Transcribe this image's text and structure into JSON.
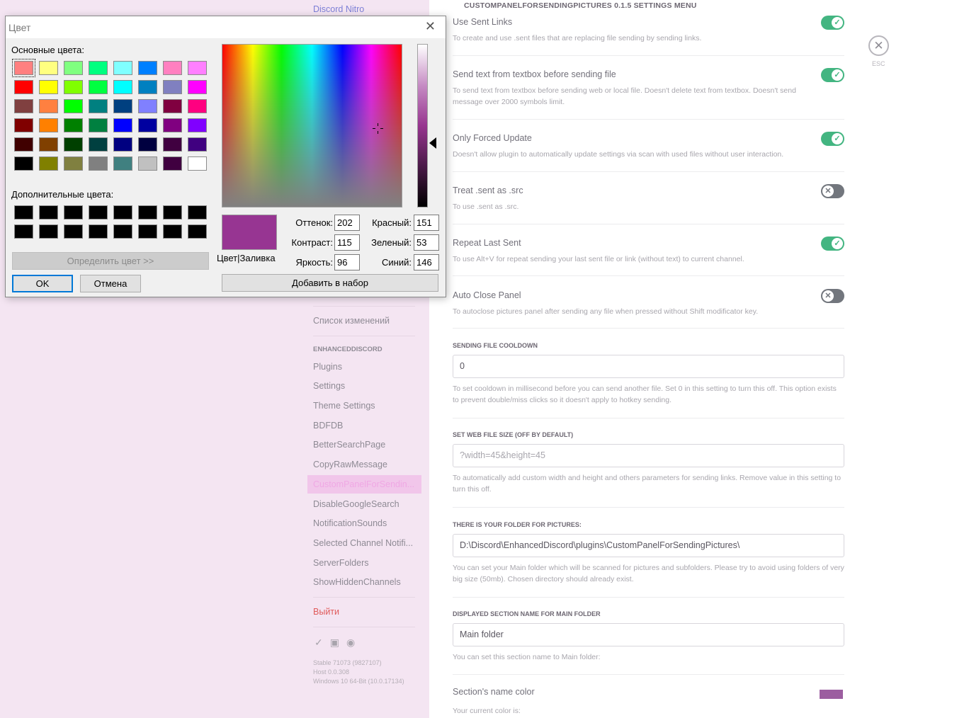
{
  "sidebar": {
    "nitro": "Discord Nitro",
    "changelog": "Список изменений",
    "header": "ENHANCEDDISCORD",
    "items": [
      "Plugins",
      "Settings",
      "Theme Settings",
      "BDFDB",
      "BetterSearchPage",
      "CopyRawMessage",
      "CustomPanelForSendin...",
      "DisableGoogleSearch",
      "NotificationSounds",
      "Selected Channel Notifi...",
      "ServerFolders",
      "ShowHiddenChannels"
    ],
    "logout": "Выйти",
    "version": [
      "Stable 71073 (9827107)",
      "Host 0.0.308",
      "Windows 10 64-Bit (10.0.17134)"
    ]
  },
  "main": {
    "title": "CUSTOMPANELFORSENDINGPICTURES 0.1.5 SETTINGS MENU",
    "esc": "ESC",
    "toggles": [
      {
        "title": "Use Sent Links",
        "desc": "To create and use .sent files that are replacing file sending by sending links.",
        "on": true
      },
      {
        "title": "Send text from textbox before sending file",
        "desc": "To send text from textbox before sending web or local file. Doesn't delete text from textbox. Doesn't send message over 2000 symbols limit.",
        "on": true
      },
      {
        "title": "Only Forced Update",
        "desc": "Doesn't allow plugin to automatically update settings via scan with used files without user interaction.",
        "on": true
      },
      {
        "title": "Treat .sent as .src",
        "desc": "To use .sent as .src.",
        "on": false
      },
      {
        "title": "Repeat Last Sent",
        "desc": "To use Alt+V for repeat sending your last sent file or link (without text) to current channel.",
        "on": true
      },
      {
        "title": "Auto Close Panel",
        "desc": "To autoclose pictures panel after sending any file when pressed without Shift modificator key.",
        "on": false
      }
    ],
    "cooldown": {
      "label": "SENDING FILE COOLDOWN",
      "value": "0",
      "desc": "To set cooldown in millisecond before you can send another file. Set 0 in this setting to turn this off. This option exists to prevent double/miss clicks so it doesn't apply to hotkey sending."
    },
    "websize": {
      "label": "SET WEB FILE SIZE (OFF BY DEFAULT)",
      "placeholder": "?width=45&height=45",
      "desc": "To automatically add custom width and height and others parameters for sending links. Remove value in this setting to turn this off."
    },
    "folder": {
      "label": "THERE IS YOUR FOLDER FOR PICTURES:",
      "value": "D:\\Discord\\EnhancedDiscord\\plugins\\CustomPanelForSendingPictures\\",
      "desc": "You can set your Main folder which will be scanned for pictures and subfolders. Please try to avoid using folders of very big size (50mb). Chosen directory should already exist."
    },
    "section_name": {
      "label": "DISPLAYED SECTION NAME FOR MAIN FOLDER",
      "value": "Main folder",
      "desc": "You can set this section name to Main folder:"
    },
    "section_color": {
      "title": "Section's name color",
      "desc": "Your current color is:",
      "color": "#9c5ea0"
    }
  },
  "dialog": {
    "title": "Цвет",
    "basic_colors_label": "Основные цвета:",
    "custom_colors_label": "Дополнительные цвета:",
    "basic_colors": [
      "#ff8080",
      "#ffff80",
      "#80ff80",
      "#00ff80",
      "#80ffff",
      "#0080ff",
      "#ff80c0",
      "#ff80ff",
      "#ff0000",
      "#ffff00",
      "#80ff00",
      "#00ff40",
      "#00ffff",
      "#0080c0",
      "#8080c0",
      "#ff00ff",
      "#804040",
      "#ff8040",
      "#00ff00",
      "#008080",
      "#004080",
      "#8080ff",
      "#800040",
      "#ff0080",
      "#800000",
      "#ff8000",
      "#008000",
      "#008040",
      "#0000ff",
      "#0000a0",
      "#800080",
      "#8000ff",
      "#400000",
      "#804000",
      "#004000",
      "#004040",
      "#000080",
      "#000040",
      "#400040",
      "#400080",
      "#000000",
      "#808000",
      "#808040",
      "#808080",
      "#408080",
      "#c0c0c0",
      "#400040",
      "#ffffff"
    ],
    "custom_colors": [
      "#000000",
      "#000000",
      "#000000",
      "#000000",
      "#000000",
      "#000000",
      "#000000",
      "#000000",
      "#000000",
      "#000000",
      "#000000",
      "#000000",
      "#000000",
      "#000000",
      "#000000",
      "#000000"
    ],
    "define_button": "Определить цвет >>",
    "ok": "OK",
    "cancel": "Отмена",
    "preview_label": "Цвет|Заливка",
    "preview_color": "#973592",
    "hue_label": "Оттенок:",
    "hue": "202",
    "sat_label": "Контраст:",
    "sat": "115",
    "lum_label": "Яркость:",
    "lum": "96",
    "red_label": "Красный:",
    "red": "151",
    "green_label": "Зеленый:",
    "green": "53",
    "blue_label": "Синий:",
    "blue": "146",
    "add_button": "Добавить в набор"
  }
}
